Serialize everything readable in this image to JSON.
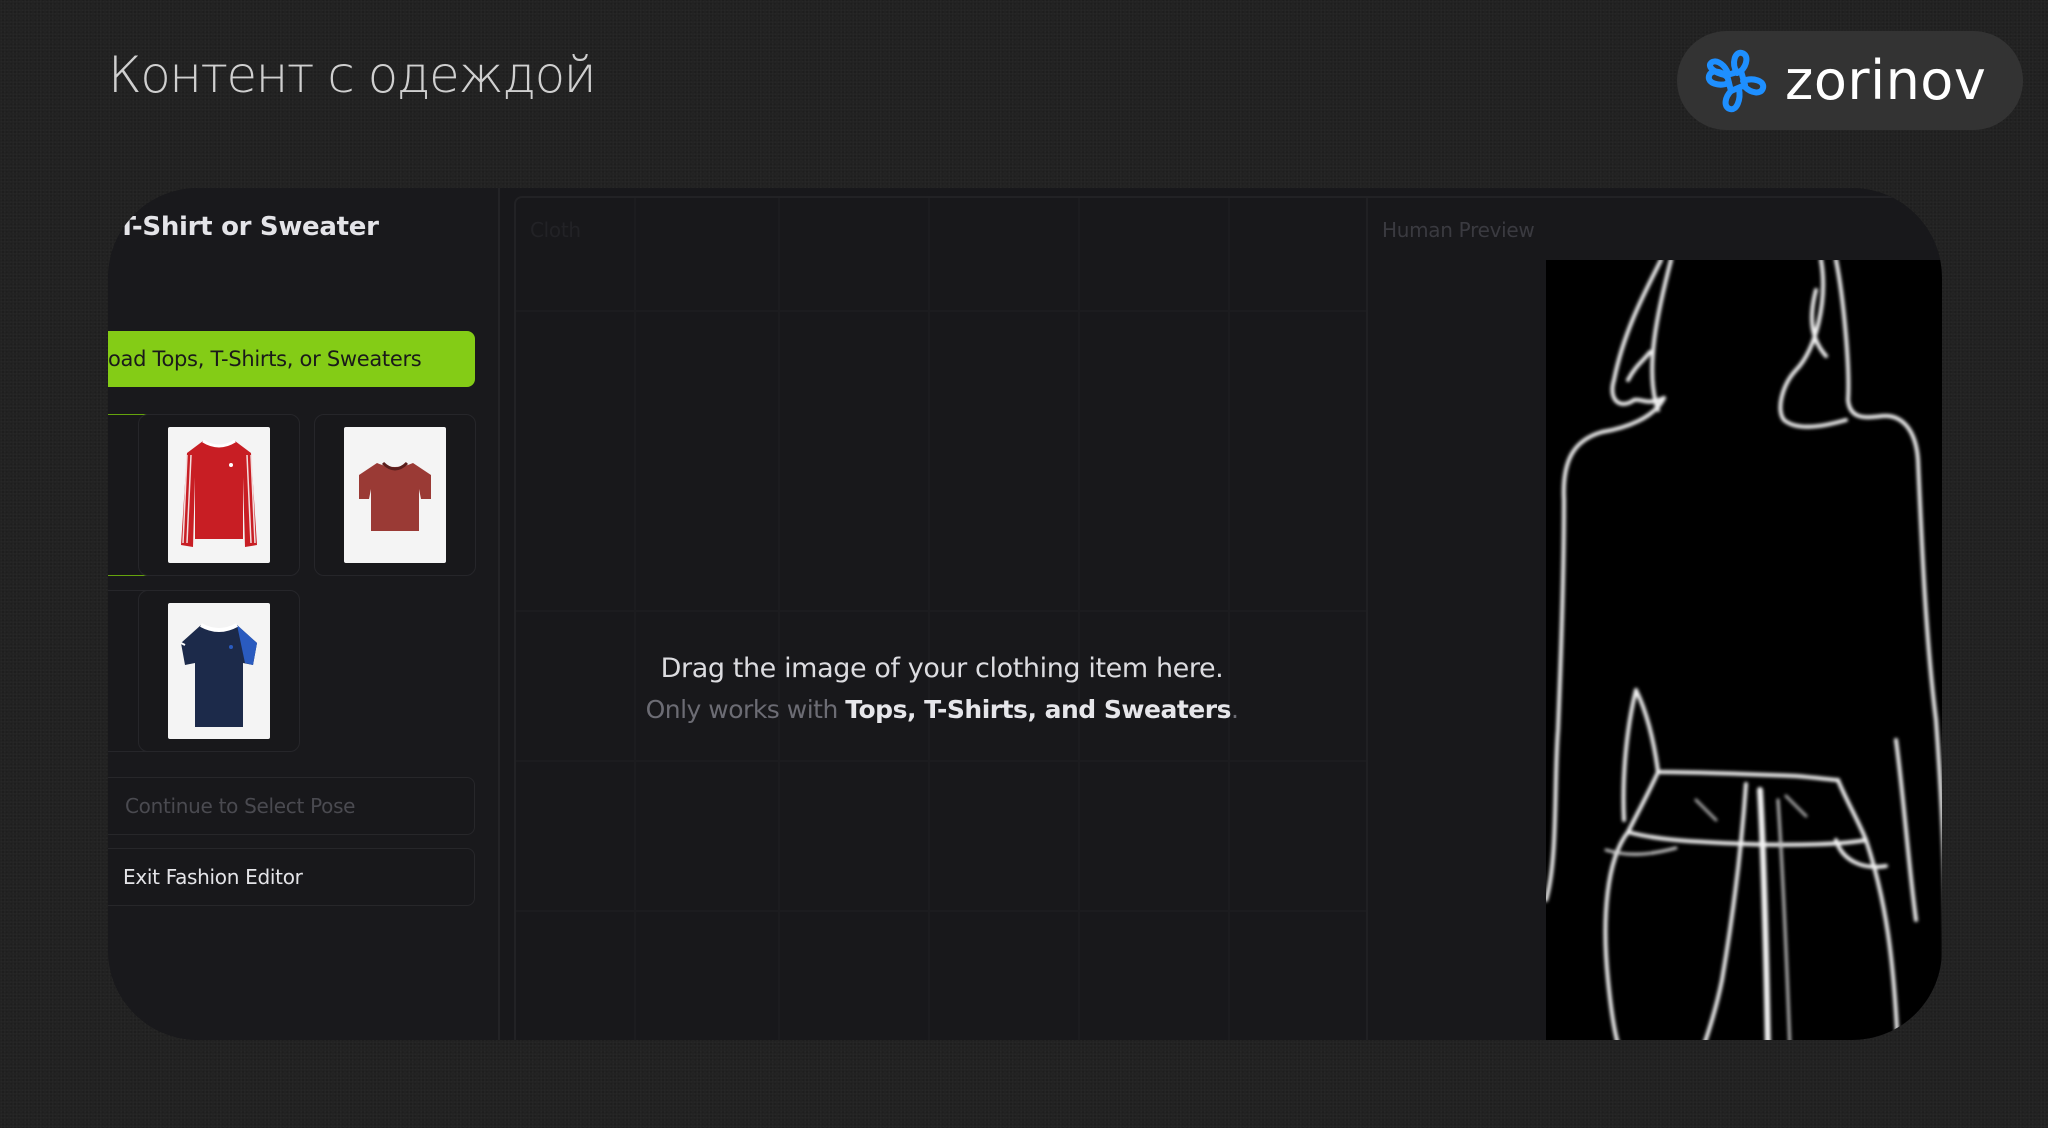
{
  "slide": {
    "title": "Контент с одеждой",
    "brand": {
      "name": "zorinov",
      "icon": "clover-knot-logo-icon",
      "accent_color": "#1e8fff"
    }
  },
  "app": {
    "sidebar": {
      "heading": "Upload T-Shirt or Sweater",
      "heading_visible": "ad T-Shirt or Sweater",
      "upload_button_label": "Upload Tops, T-Shirts, or Sweaters",
      "upload_button_visible": "oad Tops, T-Shirts, or Sweaters",
      "upload_button_color": "#84cc16",
      "thumbnails": [
        {
          "name": "selected-slot",
          "selected": true,
          "color": null
        },
        {
          "name": "red-long-sleeve-striped-top",
          "selected": false,
          "color": "#c81e24"
        },
        {
          "name": "maroon-cropped-tee",
          "selected": false,
          "color": "#9a3a35"
        },
        {
          "name": "partial-slot",
          "selected": false,
          "color": null
        },
        {
          "name": "navy-ringer-tee-blue-stripes",
          "selected": false,
          "color": "#1c2a4a"
        }
      ],
      "continue_button_label": "Continue to Select Pose",
      "exit_button_label": "Exit Fashion Editor"
    },
    "cloth_panel": {
      "label": "Cloth",
      "dropzone_line1": "Drag the image of your clothing item here.",
      "dropzone_line2_prefix": "Only works with ",
      "dropzone_line2_bold": "Tops, T-Shirts, and Sweaters",
      "dropzone_line2_suffix": "."
    },
    "human_panel": {
      "label": "Human Preview",
      "image": "edge-map-silhouette-of-woman"
    }
  }
}
